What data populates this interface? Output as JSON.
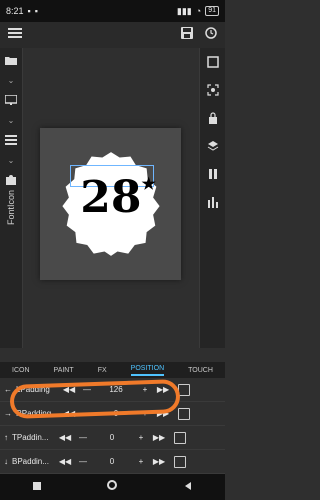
{
  "status": {
    "time": "8:21",
    "battery": "91"
  },
  "left_rail": {
    "tab_label": "FontIcon"
  },
  "canvas": {
    "badge_text": "28",
    "badge_star": "★"
  },
  "tabs": [
    "ICON",
    "PAINT",
    "FX",
    "POSITION",
    "TOUCH"
  ],
  "active_tab": "POSITION",
  "rows": [
    {
      "label": "LPadding",
      "value": "126"
    },
    {
      "label": "RPadding",
      "value": "0"
    },
    {
      "label": "TPaddin...",
      "value": "0"
    },
    {
      "label": "BPaddin...",
      "value": "0"
    }
  ]
}
